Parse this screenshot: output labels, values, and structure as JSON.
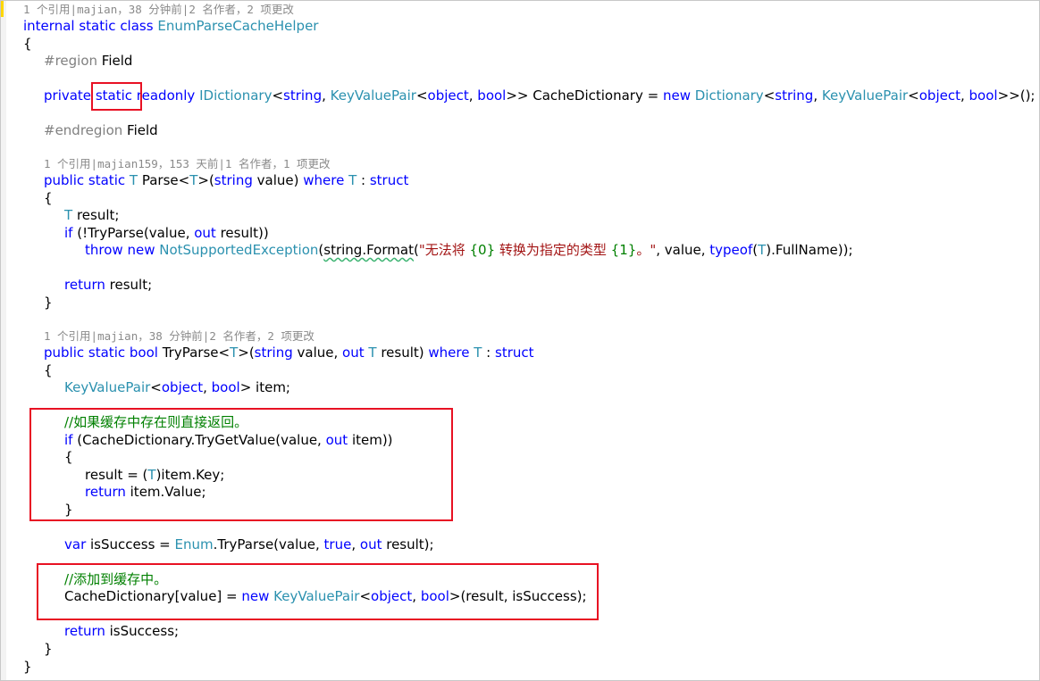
{
  "codelens": {
    "class_lens": "1 个引用|majian，38 分钟前|2 名作者，2 项更改",
    "parse_lens": "1 个引用|majian159，153 天前|1 名作者，1 项更改",
    "tryparse_lens": "1 个引用|majian，38 分钟前|2 名作者，2 项更改"
  },
  "code": {
    "kw_internal": "internal",
    "kw_static": "static",
    "kw_class": "class",
    "class_name": "EnumParseCacheHelper",
    "brace_open": "{",
    "brace_close": "}",
    "region_directive": "#region",
    "region_name": "Field",
    "endregion_directive": "#endregion",
    "kw_private": "private",
    "kw_readonly": "readonly",
    "type_idictionary": "IDictionary",
    "kw_string": "string",
    "type_kvp": "KeyValuePair",
    "kw_object": "object",
    "kw_bool": "bool",
    "field_name": "CacheDictionary",
    "kw_new": "new",
    "type_dictionary": "Dictionary",
    "kw_public": "public",
    "type_T": "T",
    "method_parse": "Parse",
    "method_tryparse": "TryParse",
    "kw_where": "where",
    "kw_struct": "struct",
    "kw_out": "out",
    "kw_if": "if",
    "kw_throw": "throw",
    "type_nse": "NotSupportedException",
    "string_format": "string.Format",
    "str_part1": "\"无法将 ",
    "str_arg0": "{0}",
    "str_part2": " 转换为指定的类型 ",
    "str_arg1": "{1}",
    "str_part3": "。\"",
    "kw_typeof": "typeof",
    "kw_return": "return",
    "kw_var": "var",
    "type_enum": "Enum",
    "kw_true": "true",
    "comment_cache_hit": "//如果缓存中存在则直接返回。",
    "comment_add_cache": "//添加到缓存中。"
  }
}
